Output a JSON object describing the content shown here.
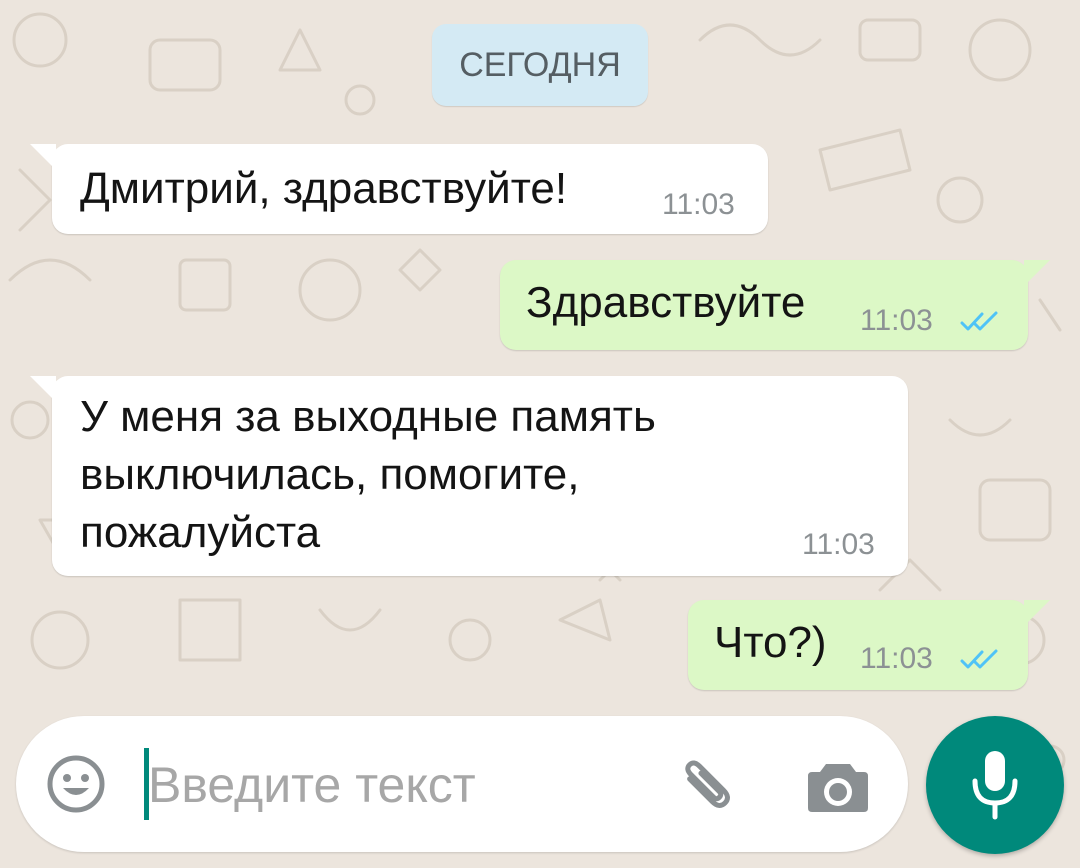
{
  "date_separator": "СЕГОДНЯ",
  "messages": [
    {
      "direction": "incoming",
      "text": "Дмитрий, здравствуйте!",
      "time": "11:03"
    },
    {
      "direction": "outgoing",
      "text": "Здравствуйте",
      "time": "11:03",
      "status": "read"
    },
    {
      "direction": "incoming",
      "lines": [
        "У меня за выходные память",
        "выключилась, помогите,",
        "пожалуйста"
      ],
      "time": "11:03"
    },
    {
      "direction": "outgoing",
      "text": "Что?)",
      "time": "11:03",
      "status": "read"
    }
  ],
  "composer": {
    "placeholder": "Введите текст",
    "left_icon": "emoji-icon",
    "right_icons": [
      "attach-icon",
      "camera-icon"
    ]
  },
  "send_button": {
    "icon": "microphone-icon"
  },
  "colors": {
    "background": "#ece5dd",
    "incoming_bubble": "#ffffff",
    "outgoing_bubble": "#dcf8c6",
    "date_chip": "#d4eaf4",
    "accent": "#00897b",
    "read_ticks": "#4fc3f7"
  }
}
